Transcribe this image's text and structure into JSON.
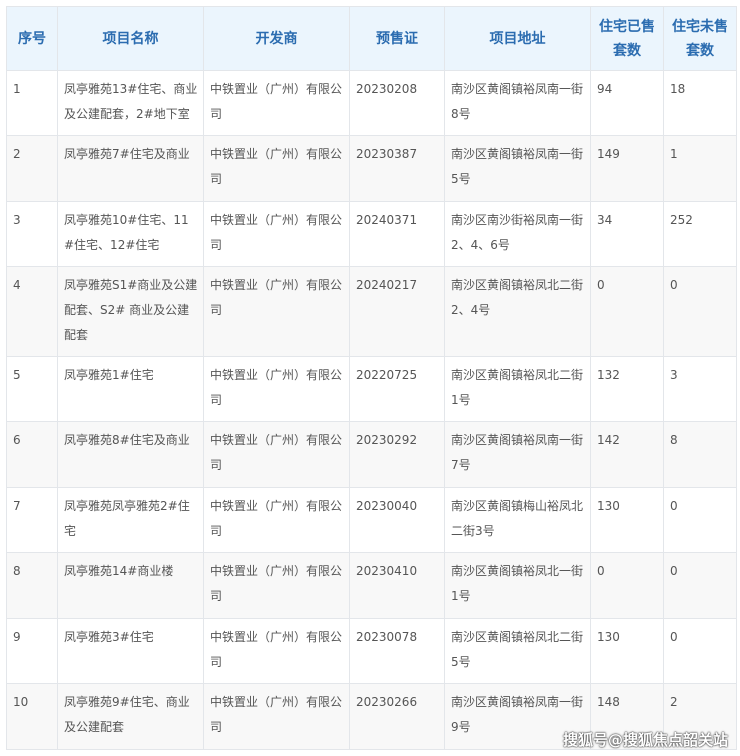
{
  "headers": [
    "序号",
    "项目名称",
    "开发商",
    "预售证",
    "项目地址",
    "住宅已售套数",
    "住宅未售套数"
  ],
  "rows": [
    [
      "1",
      "凤亭雅苑13#住宅、商业及公建配套，2#地下室",
      "中铁置业（广州）有限公司",
      "20230208",
      "南沙区黄阁镇裕凤南一街8号",
      "94",
      "18"
    ],
    [
      "2",
      "凤亭雅苑7#住宅及商业",
      "中铁置业（广州）有限公司",
      "20230387",
      "南沙区黄阁镇裕凤南一街5号",
      "149",
      "1"
    ],
    [
      "3",
      "凤亭雅苑10#住宅、11#住宅、12#住宅",
      "中铁置业（广州）有限公司",
      "20240371",
      "南沙区南沙街裕凤南一街2、4、6号",
      "34",
      "252"
    ],
    [
      "4",
      "凤亭雅苑S1#商业及公建配套、S2# 商业及公建配套",
      "中铁置业（广州）有限公司",
      "20240217",
      "南沙区黄阁镇裕凤北二街2、4号",
      "0",
      "0"
    ],
    [
      "5",
      "凤亭雅苑1#住宅",
      "中铁置业（广州）有限公司",
      "20220725",
      "南沙区黄阁镇裕凤北二街1号",
      "132",
      "3"
    ],
    [
      "6",
      "凤亭雅苑8#住宅及商业",
      "中铁置业（广州）有限公司",
      "20230292",
      "南沙区黄阁镇裕凤南一街7号",
      "142",
      "8"
    ],
    [
      "7",
      "凤亭雅苑凤亭雅苑2#住宅",
      "中铁置业（广州）有限公司",
      "20230040",
      "南沙区黄阁镇梅山裕凤北二街3号",
      "130",
      "0"
    ],
    [
      "8",
      "凤亭雅苑14#商业楼",
      "中铁置业（广州）有限公司",
      "20230410",
      "南沙区黄阁镇裕凤北一街1号",
      "0",
      "0"
    ],
    [
      "9",
      "凤亭雅苑3#住宅",
      "中铁置业（广州）有限公司",
      "20230078",
      "南沙区黄阁镇裕凤北二街5号",
      "130",
      "0"
    ],
    [
      "10",
      "凤亭雅苑9#住宅、商业及公建配套",
      "中铁置业（广州）有限公司",
      "20230266",
      "南沙区黄阁镇裕凤南一街9号",
      "148",
      "2"
    ]
  ],
  "watermark": "搜狐号@搜狐焦点韶关站"
}
